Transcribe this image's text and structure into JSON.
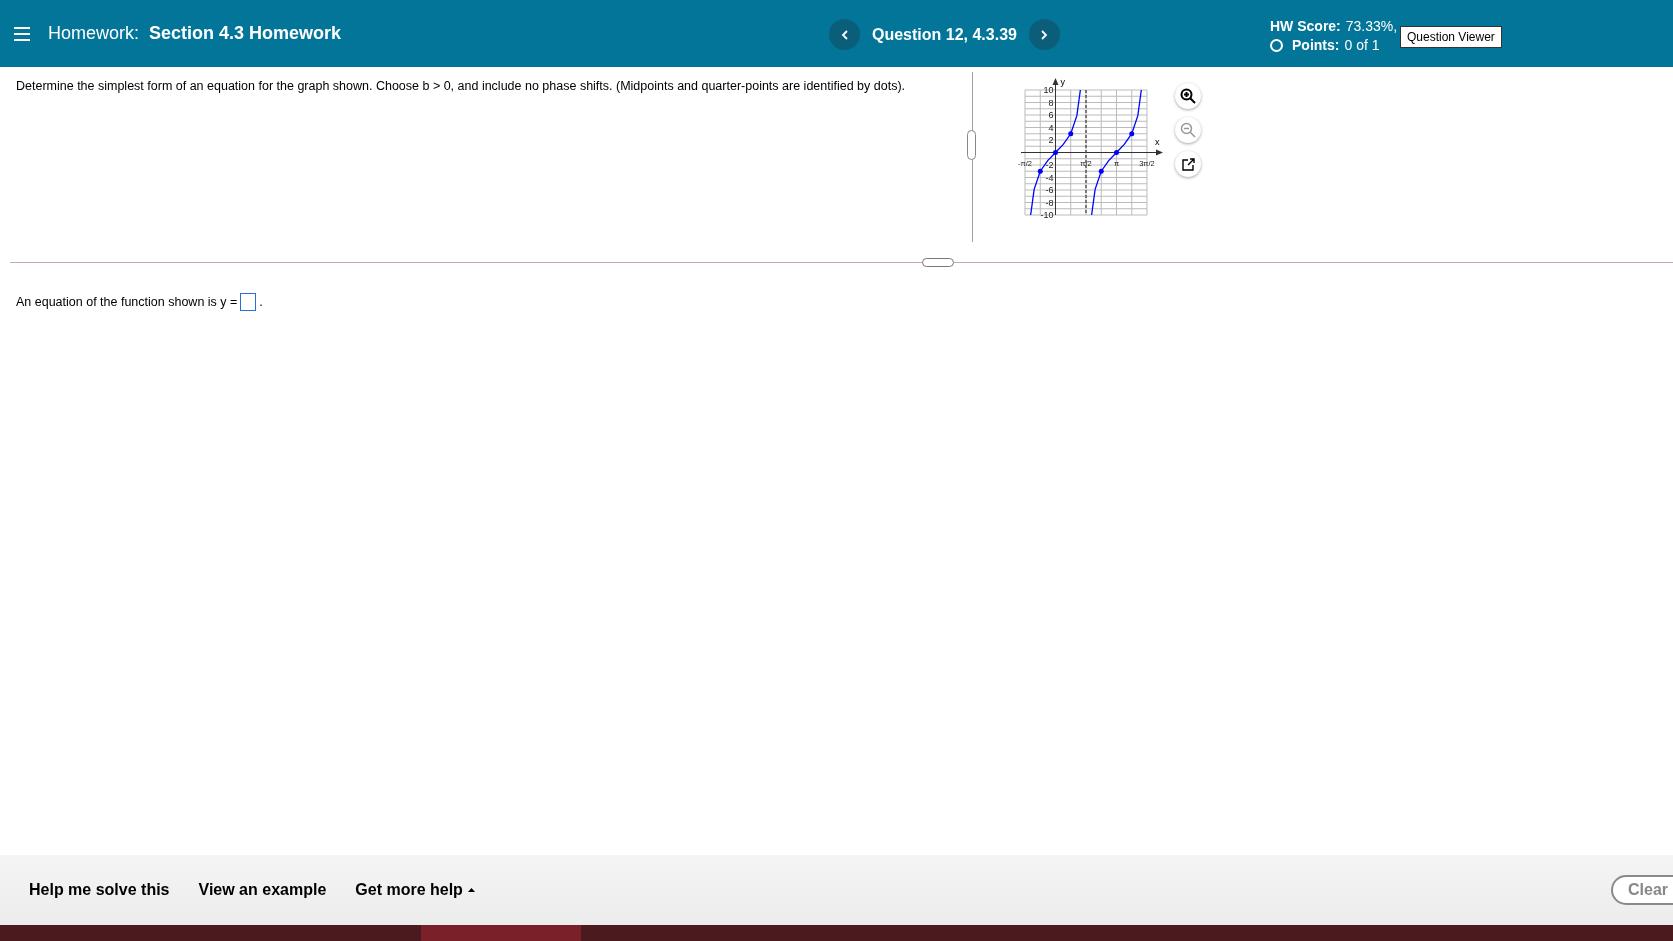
{
  "header": {
    "title_prefix": "Homework:",
    "title": "Section 4.3 Homework",
    "question": "Question 12, 4.3.39",
    "hw_score_label": "HW Score:",
    "hw_score_value": "73.33%,",
    "points_label": "Points:",
    "points_value": "0 of 1",
    "tooltip": "Question Viewer"
  },
  "question": {
    "prompt": "Determine the simplest form of an equation for the graph shown. Choose b > 0, and include no phase shifts. (Midpoints and quarter-points are identified by dots).",
    "graph": {
      "zoom_out_disabled": true,
      "chart_data": {
        "type": "line",
        "xlabel": "x",
        "ylabel": "y",
        "x": [
          -1.28,
          -1.1,
          -0.785,
          -0.4,
          0,
          0.4,
          0.785,
          1.1,
          1.28,
          1.5708,
          1.86,
          2.04,
          2.356,
          2.74,
          3.1416,
          3.54,
          3.927,
          4.24,
          4.42
        ],
        "values": [
          -10,
          -5.9,
          -3,
          -1.3,
          0,
          1.3,
          3,
          5.9,
          10,
          null,
          -10,
          -5.9,
          -3,
          -1.3,
          0,
          1.3,
          3,
          5.9,
          10
        ],
        "grid": true,
        "ref_lines": [
          {
            "axis": "x",
            "value": 1.5708
          }
        ],
        "xlim": [
          -1.5708,
          4.7124
        ],
        "ylim": [
          -10,
          10
        ],
        "xticks": [
          {
            "value": -1.5708,
            "label": "-π/2"
          },
          {
            "value": 1.5708,
            "label": "π/2"
          },
          {
            "value": 3.1416,
            "label": "π"
          },
          {
            "value": 4.7124,
            "label": "3π/2"
          }
        ],
        "yticks": [
          -10,
          -8,
          -6,
          -4,
          -2,
          2,
          4,
          6,
          8,
          10
        ]
      }
    },
    "answer_prefix": "An equation of the function shown is y =",
    "answer_suffix": "."
  },
  "footer": {
    "links": [
      {
        "label": "Help me solve this",
        "kind": "plain"
      },
      {
        "label": "View an example",
        "kind": "plain"
      },
      {
        "label": "Get more help",
        "kind": "dropdown"
      }
    ],
    "clear": "Clear"
  }
}
